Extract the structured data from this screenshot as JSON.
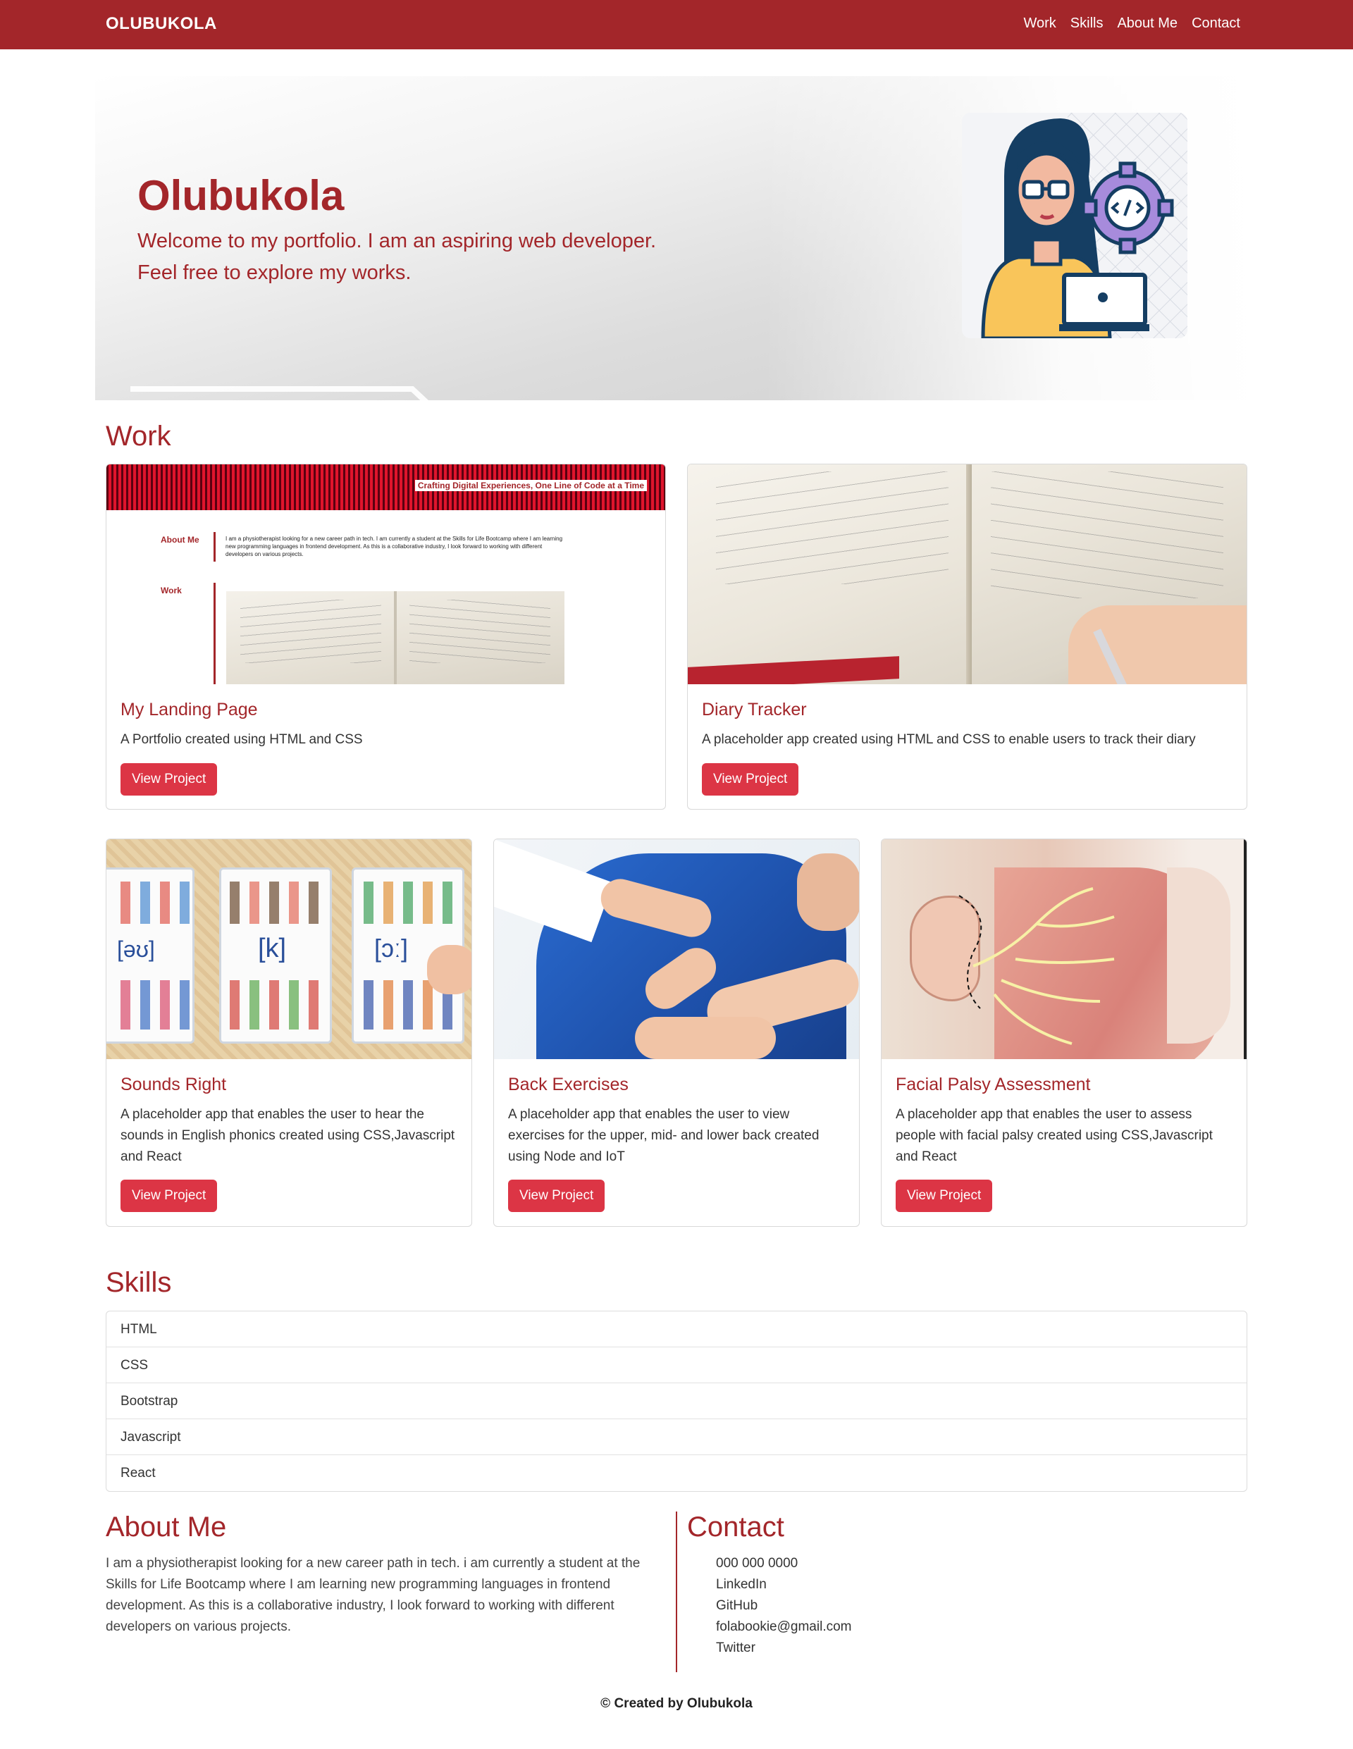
{
  "nav": {
    "brand": "OLUBUKOLA",
    "links": [
      "Work",
      "Skills",
      "About Me",
      "Contact"
    ]
  },
  "hero": {
    "title": "Olubukola",
    "line1": "Welcome to my portfolio. I am an aspiring web developer.",
    "line2": "Feel free to explore my works."
  },
  "work": {
    "heading": "Work",
    "cards": [
      {
        "title": "My Landing Page",
        "text": "A Portfolio created using HTML and CSS",
        "button": "View Project",
        "preview": {
          "banner": "Crafting Digital Experiences, One Line of Code at a Time",
          "about_label": "About Me",
          "about_text": "I am a physiotherapist looking for a new career path in tech. I am currently a student at the Skills for Life Bootcamp where I am learning new programming languages in frontend development. As this is a collaborative industry, I look forward to working with different developers on various projects.",
          "work_label": "Work"
        }
      },
      {
        "title": "Diary Tracker",
        "text": "A placeholder app created using HTML and CSS to enable users to track their diary",
        "button": "View Project"
      },
      {
        "title": "Sounds Right",
        "text": "A placeholder app that enables the user to hear the sounds in English phonics created using CSS,Javascript and React",
        "button": "View Project"
      },
      {
        "title": "Back Exercises",
        "text": "A placeholder app that enables the user to view exercises for the upper, mid- and lower back created using Node and IoT",
        "button": "View Project"
      },
      {
        "title": "Facial Palsy Assessment",
        "text": "A placeholder app that enables the user to assess people with facial palsy created using CSS,Javascript and React",
        "button": "View Project"
      }
    ]
  },
  "skills": {
    "heading": "Skills",
    "items": [
      "HTML",
      "CSS",
      "Bootstrap",
      "Javascript",
      "React"
    ]
  },
  "about": {
    "heading": "About Me",
    "text": "I am a physiotherapist looking for a new career path in tech. i am currently a student at the Skills for Life Bootcamp where I am learning new programming languages in frontend development. As this is a collaborative industry, I look forward to working with different developers on various projects."
  },
  "contact": {
    "heading": "Contact",
    "items": [
      "000 000 0000",
      "LinkedIn",
      "GitHub",
      "folabookie@gmail.com",
      "Twitter"
    ]
  },
  "footer": {
    "text": "© Created by Olubukola"
  },
  "colors": {
    "brand": "#a3262a",
    "button": "#dc3545"
  }
}
